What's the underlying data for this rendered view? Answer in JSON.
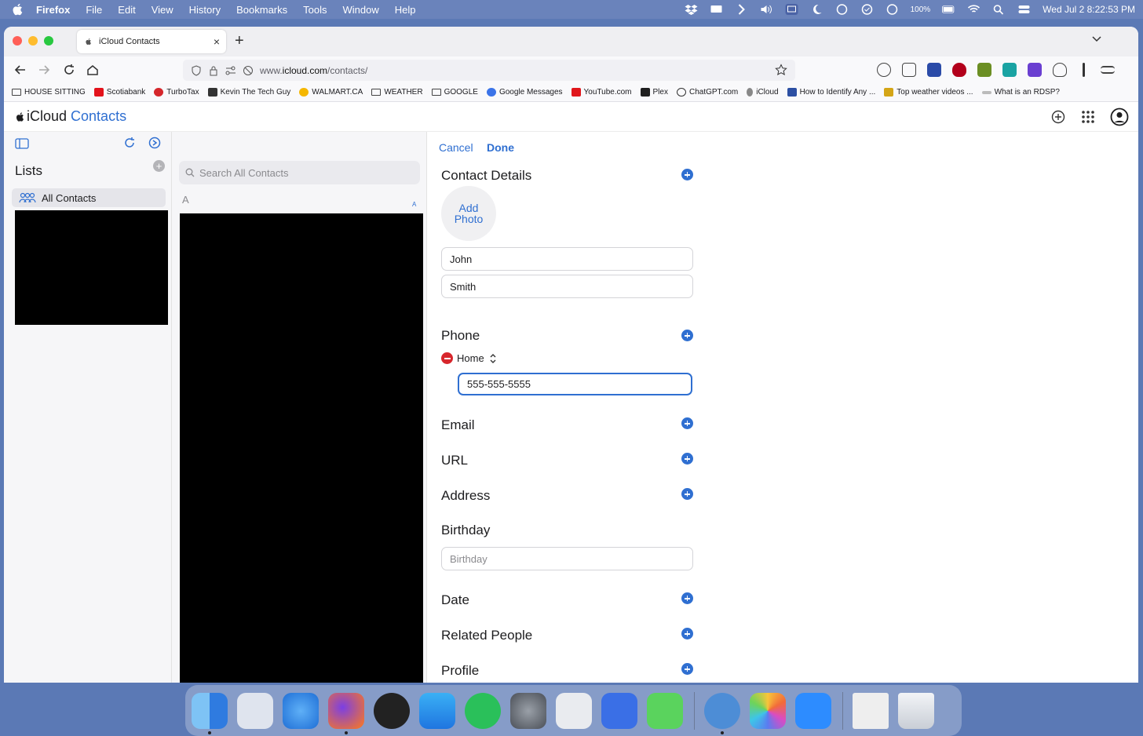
{
  "menubar": {
    "app": "Firefox",
    "items": [
      "File",
      "Edit",
      "View",
      "History",
      "Bookmarks",
      "Tools",
      "Window",
      "Help"
    ],
    "battery": "100%",
    "datetime": "Wed Jul 2  8:22:53 PM"
  },
  "browser": {
    "tab_title": "iCloud Contacts",
    "url_prefix": "www.",
    "url_domain": "icloud.com",
    "url_path": "/contacts/",
    "bookmarks": [
      "HOUSE SITTING",
      "Scotiabank",
      "TurboTax",
      "Kevin The Tech Guy",
      "WALMART.CA",
      "WEATHER",
      "GOOGLE",
      "Google Messages",
      "YouTube.com",
      "Plex",
      "ChatGPT.com",
      "iCloud",
      "How to Identify Any ...",
      "Top weather videos ...",
      "What is an RDSP?"
    ]
  },
  "app": {
    "brand": "iCloud",
    "name": "Contacts"
  },
  "sidebar": {
    "lists_title": "Lists",
    "add_symbol": "+",
    "all_contacts": "All Contacts"
  },
  "list": {
    "search_placeholder": "Search All Contacts",
    "section_letter": "A",
    "index_letter": "A"
  },
  "detail": {
    "cancel": "Cancel",
    "done": "Done",
    "contact_details_title": "Contact Details",
    "add_photo_line1": "Add",
    "add_photo_line2": "Photo",
    "first_name": "John",
    "last_name": "Smith",
    "phone_title": "Phone",
    "phone_label": "Home",
    "phone_value": "555-555-5555",
    "email_title": "Email",
    "url_title": "URL",
    "address_title": "Address",
    "birthday_title": "Birthday",
    "birthday_placeholder": "Birthday",
    "date_title": "Date",
    "related_title": "Related People",
    "profile_title": "Profile"
  },
  "colors": {
    "accent": "#2f6fd1",
    "remove": "#d7262c"
  }
}
